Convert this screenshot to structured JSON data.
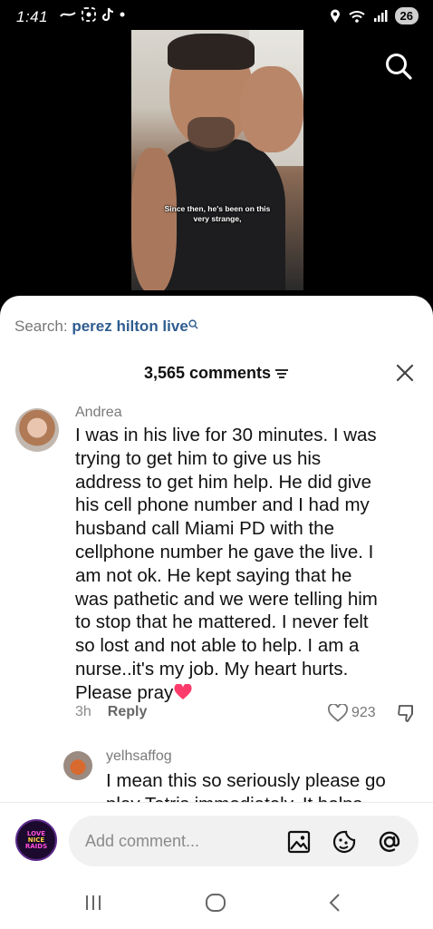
{
  "status_bar": {
    "time": "1:41",
    "battery": "26"
  },
  "video": {
    "caption_line1": "Since then, he's been on this",
    "caption_line2": "very strange,"
  },
  "search": {
    "prefix": "Search: ",
    "query": "perez hilton live"
  },
  "comments_header": {
    "count_label": "3,565 comments"
  },
  "comments": [
    {
      "username": "Andrea",
      "lines": [
        "I was in his live for 30 minutes. I was",
        "trying to get him to give us his",
        "address to get him help. He did give",
        "his cell phone number and I had my",
        "husband call Miami PD with the",
        "cellphone number he gave the live. I",
        "am not ok. He kept saying that he",
        "was pathetic and we were telling him",
        "to stop that he mattered. I never felt",
        "so lost and not able to help. I am a",
        "nurse..it's my job. My heart hurts.",
        "Please pray"
      ],
      "time": "3h",
      "reply_label": "Reply",
      "likes": "923"
    }
  ],
  "reply": {
    "username": "yelhsaffog",
    "line1": "I mean this so seriously please go",
    "line2": "play Tetris immediately. It helps"
  },
  "input": {
    "placeholder": "Add comment...",
    "avatar_text": "LOVE NICE RAIDS"
  },
  "colors": {
    "link": "#2f5d8f",
    "heart": "#ff3b6b"
  }
}
